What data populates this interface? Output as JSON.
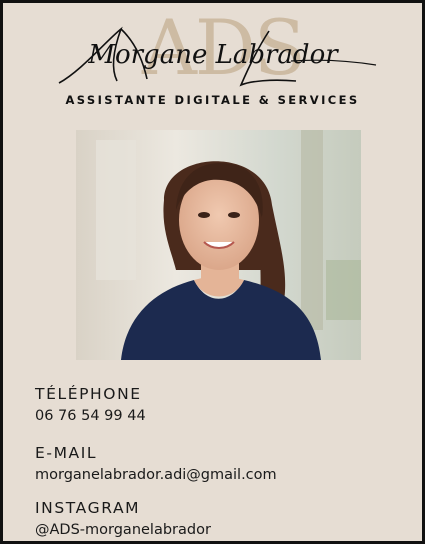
{
  "logo": {
    "letters": "ADS",
    "script_name": "Morgane Labrador",
    "tagline": "ASSISTANTE DIGITALE & SERVICES"
  },
  "photo": {
    "subject": "portrait-photo"
  },
  "contacts": {
    "phone": {
      "label": "TÉLÉPHONE",
      "value": "06 76 54 99 44"
    },
    "email": {
      "label": "E-MAIL",
      "value": "morganelabrador.adi@gmail.com"
    },
    "instagram": {
      "label": "INSTAGRAM",
      "value": "@ADS-morganelabrador"
    }
  },
  "colors": {
    "background": "#e6ddd3",
    "logo_letters": "#cdbba3",
    "text": "#1a1a1a",
    "border": "#111111"
  }
}
